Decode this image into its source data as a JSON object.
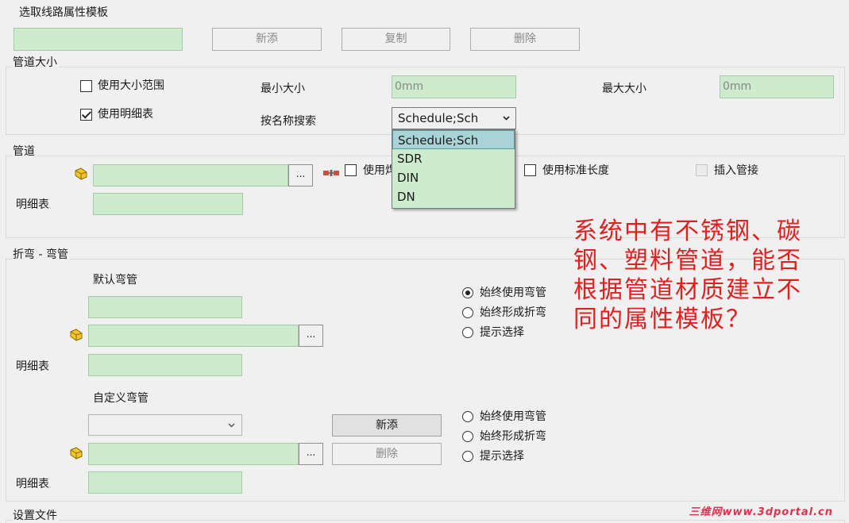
{
  "template": {
    "title": "选取线路属性模板",
    "buttons": {
      "add": "新添",
      "copy": "复制",
      "delete": "删除"
    }
  },
  "size_section": {
    "title": "管道大小",
    "use_range_label": "使用大小范围",
    "use_range_checked": false,
    "use_table_label": "使用明细表",
    "use_table_checked": true,
    "min_label": "最小大小",
    "min_value": "0mm",
    "max_label": "最大大小",
    "max_value": "0mm",
    "search_label": "按名称搜索",
    "search_value": "Schedule;Sch",
    "search_options": [
      "Schedule;Sch",
      "SDR",
      "DIN",
      "DN"
    ]
  },
  "pipe_section": {
    "title": "管道",
    "browse": "...",
    "use_fitting_label": "使用焊",
    "use_std_length_label": "使用标准长度",
    "insert_fitting_label": "插入管接",
    "table_label": "明细表"
  },
  "bend_section": {
    "title": "折弯 - 弯管",
    "default_elbow": {
      "title": "默认弯管",
      "browse": "...",
      "table_label": "明细表",
      "options": [
        "始终使用弯管",
        "始终形成折弯",
        "提示选择"
      ],
      "selected": 0
    },
    "custom_elbow": {
      "title": "自定义弯管",
      "add_button": "新添",
      "delete_button": "删除",
      "browse": "...",
      "table_label": "明细表",
      "options": [
        "始终使用弯管",
        "始终形成折弯",
        "提示选择"
      ]
    }
  },
  "settings_section": {
    "title": "设置文件"
  },
  "annotation": {
    "lines": [
      "系统中有不锈钢、碳",
      "钢、塑料管道，能否",
      "根据管道材质建立不",
      "同的属性模板？"
    ],
    "color": "#e02020"
  },
  "watermark": "三维网www.3dportal.cn"
}
